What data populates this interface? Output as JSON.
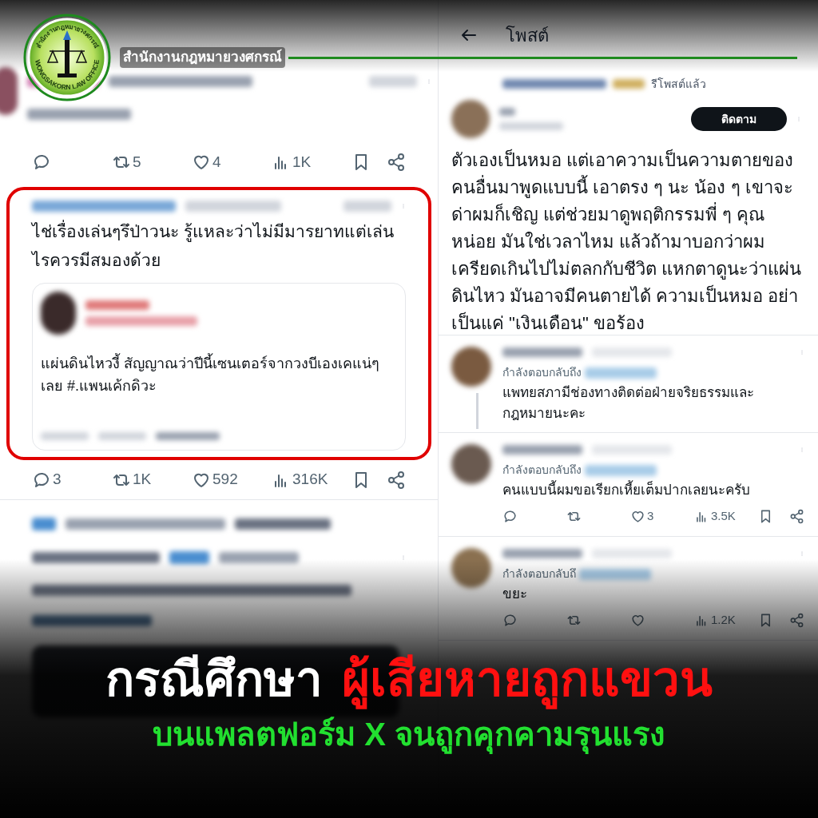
{
  "brand": {
    "name": "สำนักงานกฎหมายวงศกรณ์",
    "logo_top": "สำนักงานกฎหมายวงศกรณ์",
    "logo_bottom": "WONGSAKORN LAW OFFICE"
  },
  "left_feed": {
    "first_post_actions": [
      {
        "kind": "reply"
      },
      {
        "kind": "repost",
        "count": "5"
      },
      {
        "kind": "like",
        "count": "4"
      },
      {
        "kind": "views",
        "count": "1K"
      }
    ],
    "highlighted_post": {
      "text": "ไช่เรื่องเล่นๆรึป่าวนะ รู้แหละว่าไม่มีมารยาทแต่เล่นไรควรมีสมองด้วย",
      "quote_text": "แผ่นดินไหวงี้ สัญญาณว่าปีนี้เซนเตอร์จากวงบีเองเคแน่ๆเลย #.แพนเค้กดิวะ",
      "actions": [
        {
          "kind": "reply",
          "count": "3"
        },
        {
          "kind": "repost",
          "count": "1K"
        },
        {
          "kind": "like",
          "count": "592"
        },
        {
          "kind": "views",
          "count": "316K"
        }
      ]
    }
  },
  "post_view": {
    "title": "โพสต์",
    "repost_label": "รีโพสต์แล้ว",
    "follow_button": "ติดตาม",
    "text": "ตัวเองเป็นหมอ แต่เอาความเป็นความตายของคนอื่นมาพูดแบบนี้ เอาตรง ๆ นะ น้อง ๆ เขาจะด่าผมก็เชิญ แต่ช่วยมาดูพฤติกรรมพี่ ๆ คุณหน่อย มันใช่เวลาไหม แล้วถ้ามาบอกว่าผมเครียดเกินไปไม่ตลกกับชีวิต แหกตาดูนะว่าแผ่นดินไหว มันอาจมีคนตายได้ ความเป็นหมอ อย่าเป็นแค่ \"เงินเดือน\" ขอร้อง",
    "replies": [
      {
        "reply_label": "กำลังตอบกลับถึง",
        "text": "แพทยสภามีช่องทางติดต่อฝ่ายจริยธรรมและกฎหมายนะคะ",
        "thread_line": true
      },
      {
        "reply_label": "กำลังตอบกลับถึง",
        "text": "คนแบบนี้ผมขอเรียกเหี้ยเต็มปากเลยนะครับ",
        "thread_line": false,
        "actions": [
          {
            "kind": "reply"
          },
          {
            "kind": "repost"
          },
          {
            "kind": "like",
            "count": "3"
          },
          {
            "kind": "views",
            "count": "3.5K"
          }
        ]
      },
      {
        "reply_label": "กำลังตอบกลับถึ",
        "text": "ขยะ",
        "thread_line": false,
        "actions": [
          {
            "kind": "reply"
          },
          {
            "kind": "repost"
          },
          {
            "kind": "like"
          },
          {
            "kind": "views",
            "count": "1.2K"
          }
        ]
      }
    ]
  },
  "headline": {
    "lead": "กรณีศึกษา",
    "highlight": "ผู้เสียหายถูกแขวน",
    "subline": "บนแพลตฟอร์ม X จนถูกคุกคามรุนแรง"
  }
}
